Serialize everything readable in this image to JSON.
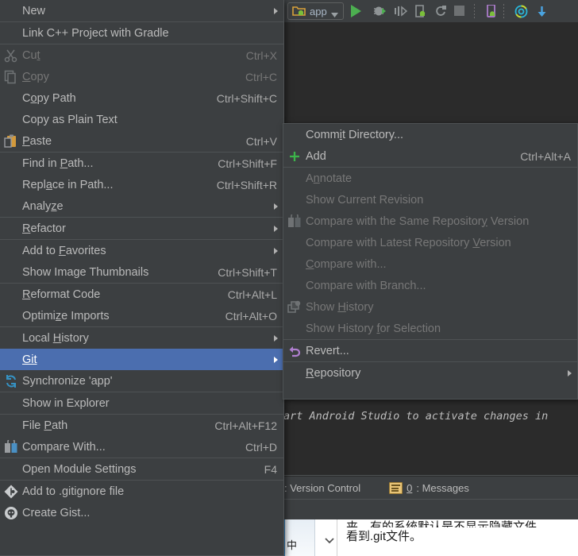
{
  "app": {
    "name": "Android Studio",
    "theme": "darcula",
    "accent_highlight": "#4b6eaf",
    "menu_bg": "#3c3f41",
    "editor_bg": "#2b2b2b"
  },
  "toolbar": {
    "module_selector": {
      "label": "app",
      "icon": "module-folder-icon",
      "dropdown_icon": "chevron-down-icon"
    },
    "buttons": [
      {
        "name": "run-button",
        "icon": "play-icon",
        "color": "#4caf50"
      },
      {
        "name": "debug-button",
        "icon": "bug-icon",
        "color": "#8f9496"
      },
      {
        "name": "run-with-coverage-button",
        "icon": "coverage-icon",
        "color": "#8f9496"
      },
      {
        "name": "attach-debugger-button",
        "icon": "attach-android-icon",
        "color": "#8f9496"
      },
      {
        "name": "rerun-button",
        "icon": "rerun-icon",
        "color": "#8f9496"
      },
      {
        "name": "stop-button",
        "icon": "stop-icon",
        "color": "#6e7173"
      },
      {
        "name": "avd-manager-button",
        "icon": "avd-manager-icon",
        "color": "#b07fd0"
      },
      {
        "name": "sdk-manager-button",
        "icon": "sdk-manager-icon",
        "color": "#29b6d8"
      },
      {
        "name": "sync-gradle-button",
        "icon": "gradle-sync-icon",
        "color": "#4aa3df"
      }
    ]
  },
  "editor": {
    "message_line": "art Android Studio to activate changes in"
  },
  "statusbar": {
    "version_control": {
      "label": ": Version Control"
    },
    "messages": {
      "shortcut_letter": "0",
      "label": ": Messages",
      "icon": "messages-icon"
    }
  },
  "document": {
    "clipped_line": "夹，有的系统默认是不显示隐藏文件",
    "visible_line": "看到.git文件。",
    "side_label": "中",
    "chevron": "chevron-down-icon"
  },
  "context_menu": {
    "name": "project-context-menu",
    "groups": [
      {
        "items": [
          {
            "label": "New",
            "icon": null,
            "shortcut": "",
            "submenu": true,
            "disabled": false,
            "selected": false,
            "mnemonic": ""
          }
        ]
      },
      {
        "items": [
          {
            "label": "Link C++ Project with Gradle",
            "icon": null,
            "shortcut": "",
            "submenu": false,
            "disabled": false,
            "selected": false,
            "mnemonic": ""
          }
        ]
      },
      {
        "items": [
          {
            "label": "Cut",
            "icon": "scissors-icon",
            "shortcut": "Ctrl+X",
            "submenu": false,
            "disabled": true,
            "selected": false,
            "mnemonic": "t"
          },
          {
            "label": "Copy",
            "icon": "copy-pages-icon",
            "shortcut": "Ctrl+C",
            "submenu": false,
            "disabled": true,
            "selected": false,
            "mnemonic": "C"
          },
          {
            "label": "Copy Path",
            "icon": null,
            "shortcut": "Ctrl+Shift+C",
            "submenu": false,
            "disabled": false,
            "selected": false,
            "mnemonic": "o"
          },
          {
            "label": "Copy as Plain Text",
            "icon": null,
            "shortcut": "",
            "submenu": false,
            "disabled": false,
            "selected": false,
            "mnemonic": ""
          },
          {
            "label": "Paste",
            "icon": "clipboard-paste-icon",
            "shortcut": "Ctrl+V",
            "submenu": false,
            "disabled": false,
            "selected": false,
            "mnemonic": "P"
          }
        ]
      },
      {
        "items": [
          {
            "label": "Find in Path...",
            "icon": null,
            "shortcut": "Ctrl+Shift+F",
            "submenu": false,
            "disabled": false,
            "selected": false,
            "mnemonic": "P"
          },
          {
            "label": "Replace in Path...",
            "icon": null,
            "shortcut": "Ctrl+Shift+R",
            "submenu": false,
            "disabled": false,
            "selected": false,
            "mnemonic": "a"
          },
          {
            "label": "Analyze",
            "icon": null,
            "shortcut": "",
            "submenu": true,
            "disabled": false,
            "selected": false,
            "mnemonic": "z"
          }
        ]
      },
      {
        "items": [
          {
            "label": "Refactor",
            "icon": null,
            "shortcut": "",
            "submenu": true,
            "disabled": false,
            "selected": false,
            "mnemonic": "R"
          }
        ]
      },
      {
        "items": [
          {
            "label": "Add to Favorites",
            "icon": null,
            "shortcut": "",
            "submenu": true,
            "disabled": false,
            "selected": false,
            "mnemonic": "F"
          },
          {
            "label": "Show Image Thumbnails",
            "icon": null,
            "shortcut": "Ctrl+Shift+T",
            "submenu": false,
            "disabled": false,
            "selected": false,
            "mnemonic": ""
          }
        ]
      },
      {
        "items": [
          {
            "label": "Reformat Code",
            "icon": null,
            "shortcut": "Ctrl+Alt+L",
            "submenu": false,
            "disabled": false,
            "selected": false,
            "mnemonic": "R"
          },
          {
            "label": "Optimize Imports",
            "icon": null,
            "shortcut": "Ctrl+Alt+O",
            "submenu": false,
            "disabled": false,
            "selected": false,
            "mnemonic": "z"
          }
        ]
      },
      {
        "items": [
          {
            "label": "Local History",
            "icon": null,
            "shortcut": "",
            "submenu": true,
            "disabled": false,
            "selected": false,
            "mnemonic": "H"
          },
          {
            "label": "Git",
            "icon": null,
            "shortcut": "",
            "submenu": true,
            "disabled": false,
            "selected": true,
            "mnemonic": "G"
          },
          {
            "label": "Synchronize 'app'",
            "icon": "synchronize-icon",
            "shortcut": "",
            "submenu": false,
            "disabled": false,
            "selected": false,
            "mnemonic": ""
          }
        ]
      },
      {
        "items": [
          {
            "label": "Show in Explorer",
            "icon": null,
            "shortcut": "",
            "submenu": false,
            "disabled": false,
            "selected": false,
            "mnemonic": ""
          }
        ]
      },
      {
        "items": [
          {
            "label": "File Path",
            "icon": null,
            "shortcut": "Ctrl+Alt+F12",
            "submenu": false,
            "disabled": false,
            "selected": false,
            "mnemonic": "P"
          },
          {
            "label": "Compare With...",
            "icon": "compare-icon",
            "shortcut": "Ctrl+D",
            "submenu": false,
            "disabled": false,
            "selected": false,
            "mnemonic": ""
          }
        ]
      },
      {
        "items": [
          {
            "label": "Open Module Settings",
            "icon": null,
            "shortcut": "F4",
            "submenu": false,
            "disabled": false,
            "selected": false,
            "mnemonic": ""
          }
        ]
      },
      {
        "items": [
          {
            "label": "Add to .gitignore file",
            "icon": "gitignore-diamond-icon",
            "shortcut": "",
            "submenu": false,
            "disabled": false,
            "selected": false,
            "mnemonic": ""
          },
          {
            "label": "Create Gist...",
            "icon": "github-octocat-icon",
            "shortcut": "",
            "submenu": false,
            "disabled": false,
            "selected": false,
            "mnemonic": ""
          }
        ]
      }
    ]
  },
  "git_submenu": {
    "name": "git-submenu",
    "groups": [
      {
        "items": [
          {
            "label": "Commit Directory...",
            "icon": null,
            "shortcut": "",
            "submenu": false,
            "disabled": false,
            "selected": false,
            "mnemonic": "i"
          },
          {
            "label": "Add",
            "icon": "plus-icon",
            "shortcut": "Ctrl+Alt+A",
            "submenu": false,
            "disabled": false,
            "selected": false,
            "mnemonic": ""
          }
        ]
      },
      {
        "items": [
          {
            "label": "Annotate",
            "icon": null,
            "shortcut": "",
            "submenu": false,
            "disabled": true,
            "selected": false,
            "mnemonic": "n"
          },
          {
            "label": "Show Current Revision",
            "icon": null,
            "shortcut": "",
            "submenu": false,
            "disabled": true,
            "selected": false,
            "mnemonic": ""
          },
          {
            "label": "Compare with the Same Repository Version",
            "icon": "compare-icon",
            "shortcut": "",
            "submenu": false,
            "disabled": true,
            "selected": false,
            "mnemonic": "y"
          },
          {
            "label": "Compare with Latest Repository Version",
            "icon": null,
            "shortcut": "",
            "submenu": false,
            "disabled": true,
            "selected": false,
            "mnemonic": "V"
          },
          {
            "label": "Compare with...",
            "icon": null,
            "shortcut": "",
            "submenu": false,
            "disabled": true,
            "selected": false,
            "mnemonic": "C"
          },
          {
            "label": "Compare with Branch...",
            "icon": null,
            "shortcut": "",
            "submenu": false,
            "disabled": true,
            "selected": false,
            "mnemonic": ""
          },
          {
            "label": "Show History",
            "icon": "show-history-icon",
            "shortcut": "",
            "submenu": false,
            "disabled": true,
            "selected": false,
            "mnemonic": "H"
          },
          {
            "label": "Show History for Selection",
            "icon": null,
            "shortcut": "",
            "submenu": false,
            "disabled": true,
            "selected": false,
            "mnemonic": "f"
          }
        ]
      },
      {
        "items": [
          {
            "label": "Revert...",
            "icon": "revert-arrow-icon",
            "shortcut": "",
            "submenu": false,
            "disabled": false,
            "selected": false,
            "mnemonic": ""
          }
        ]
      },
      {
        "items": [
          {
            "label": "Repository",
            "icon": null,
            "shortcut": "",
            "submenu": true,
            "disabled": false,
            "selected": false,
            "mnemonic": "R"
          }
        ]
      }
    ]
  }
}
